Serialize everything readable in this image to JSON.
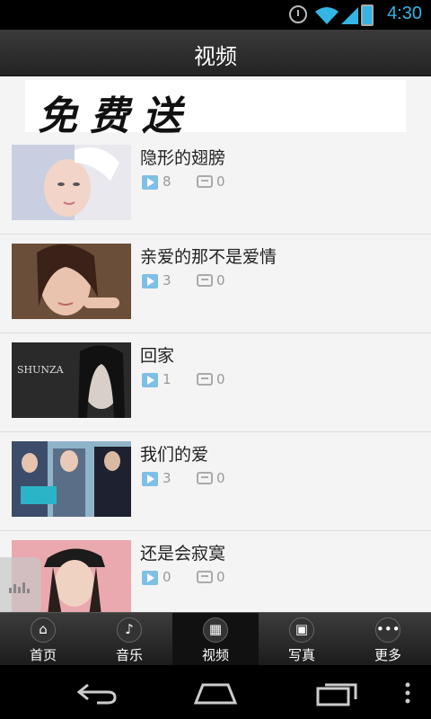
{
  "status_bar": {
    "time": "4:30"
  },
  "header": {
    "title": "视频"
  },
  "banner": {
    "text": "免费送"
  },
  "videos": [
    {
      "title": "隐形的翅膀",
      "plays": "8",
      "comments": "0"
    },
    {
      "title": "亲爱的那不是爱情",
      "plays": "3",
      "comments": "0"
    },
    {
      "title": "回家",
      "plays": "1",
      "comments": "0"
    },
    {
      "title": "我们的爱",
      "plays": "3",
      "comments": "0"
    },
    {
      "title": "还是会寂寞",
      "plays": "0",
      "comments": "0"
    }
  ],
  "thumb_captions": {
    "item3": "SHUNZA"
  },
  "tabs": [
    {
      "label": "首页",
      "icon": "home-icon",
      "glyph": "⌂"
    },
    {
      "label": "音乐",
      "icon": "music-icon",
      "glyph": "♪"
    },
    {
      "label": "视频",
      "icon": "video-icon",
      "glyph": "▦"
    },
    {
      "label": "写真",
      "icon": "photo-icon",
      "glyph": "▣"
    },
    {
      "label": "更多",
      "icon": "more-icon",
      "glyph": "•••"
    }
  ],
  "active_tab": 2,
  "colors": {
    "accent": "#33b5e5",
    "play_icon": "#7fbfe6"
  }
}
